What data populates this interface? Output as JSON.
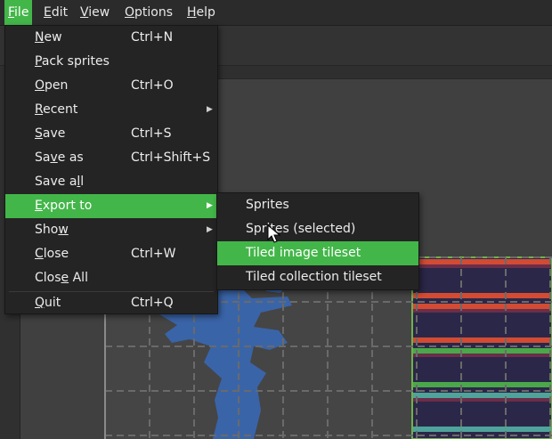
{
  "menubar": {
    "items": [
      {
        "name": "file",
        "mnemonic": "F",
        "rest": "ile"
      },
      {
        "name": "edit",
        "mnemonic": "E",
        "rest": "dit"
      },
      {
        "name": "view",
        "mnemonic": "V",
        "rest": "iew"
      },
      {
        "name": "options",
        "mnemonic": "O",
        "rest": "ptions"
      },
      {
        "name": "help",
        "mnemonic": "H",
        "rest": "elp"
      }
    ]
  },
  "file_menu": {
    "items": [
      {
        "pre": "",
        "mn": "N",
        "post": "ew",
        "shortcut": "Ctrl+N",
        "submenu": false
      },
      {
        "pre": "",
        "mn": "P",
        "post": "ack sprites",
        "shortcut": "",
        "submenu": false
      },
      {
        "pre": "",
        "mn": "O",
        "post": "pen",
        "shortcut": "Ctrl+O",
        "submenu": false
      },
      {
        "pre": "",
        "mn": "R",
        "post": "ecent",
        "shortcut": "",
        "submenu": true
      },
      {
        "pre": "",
        "mn": "S",
        "post": "ave",
        "shortcut": "Ctrl+S",
        "submenu": false
      },
      {
        "pre": "Sa",
        "mn": "v",
        "post": "e as",
        "shortcut": "Ctrl+Shift+S",
        "submenu": false
      },
      {
        "pre": "Save a",
        "mn": "l",
        "post": "l",
        "shortcut": "",
        "submenu": false
      },
      {
        "pre": "",
        "mn": "E",
        "post": "xport to",
        "shortcut": "",
        "submenu": true
      },
      {
        "pre": "Sho",
        "mn": "w",
        "post": "",
        "shortcut": "",
        "submenu": true
      },
      {
        "pre": "",
        "mn": "C",
        "post": "lose",
        "shortcut": "Ctrl+W",
        "submenu": false
      },
      {
        "pre": "Clos",
        "mn": "e",
        "post": " All",
        "shortcut": "",
        "submenu": false
      },
      {
        "pre": "",
        "mn": "Q",
        "post": "uit",
        "shortcut": "Ctrl+Q",
        "submenu": false
      }
    ]
  },
  "export_submenu": {
    "items": [
      {
        "label": "Sprites"
      },
      {
        "label": "Sprites (selected)"
      },
      {
        "label": "Tiled image tileset"
      },
      {
        "label": "Tiled collection tileset"
      }
    ]
  },
  "state": {
    "open_menu": "File",
    "highlighted_file_item": "Export to",
    "highlighted_submenu_item": "Tiled image tileset"
  },
  "colors": {
    "accent": "#43b649",
    "menu_bg": "#242424",
    "canvas_bg": "#404040",
    "water": "#3a64a8",
    "tile_dark": "#2b2748",
    "tile_red": "#d24b33",
    "tile_green": "#4aa84a",
    "tile_teal": "#4fa39a"
  }
}
